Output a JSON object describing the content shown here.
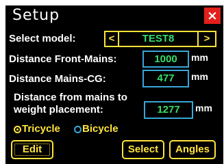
{
  "header": {
    "title": "Setup",
    "close_icon": "×"
  },
  "model": {
    "label": "Select model:",
    "prev": "<",
    "value": "TEST8",
    "next": ">"
  },
  "front_mains": {
    "label": "Distance Front-Mains:",
    "value": "1000",
    "unit": "mm"
  },
  "mains_cg": {
    "label": "Distance Mains-CG:",
    "value": "477",
    "unit": "mm"
  },
  "weight": {
    "label_line1": "Distance from mains to",
    "label_line2": "weight placement:",
    "value": "1277",
    "unit": "mm"
  },
  "gear_type": {
    "options": [
      "Tricycle",
      "Bicycle"
    ],
    "selected": "Tricycle"
  },
  "buttons": {
    "edit": "Edit",
    "select": "Select",
    "angles": "Angles"
  },
  "colors": {
    "accent_yellow": "#ffe43b",
    "value_green": "#33e06a",
    "field_cyan": "#3aa6d8",
    "close_red": "#e3201b",
    "background": "#000000"
  }
}
